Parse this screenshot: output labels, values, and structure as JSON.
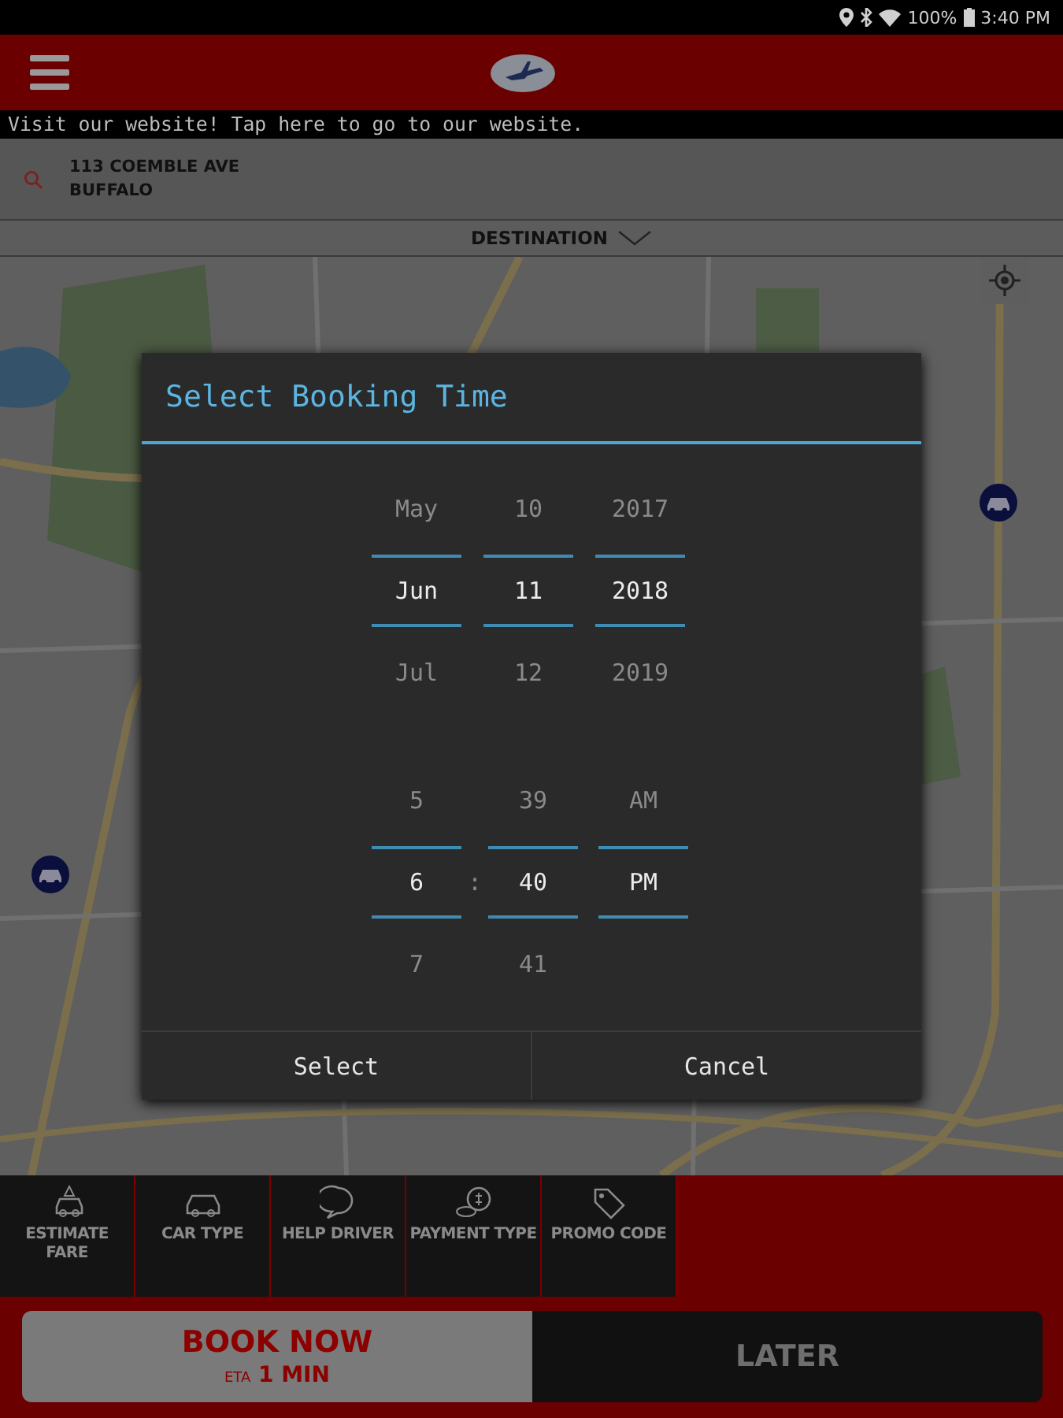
{
  "status_bar": {
    "battery": "100%",
    "time": "3:40 PM"
  },
  "banner": {
    "text": "Visit our website! Tap here to go to our website."
  },
  "pickup": {
    "lines": [
      "113 COEMBLE AVE",
      "BUFFALO"
    ]
  },
  "destination": {
    "label": "DESTINATION"
  },
  "dialog": {
    "title": "Select Booking Time",
    "date_columns": [
      {
        "items": [
          {
            "value": "May",
            "selected": false
          },
          {
            "value": "Jun",
            "selected": true
          },
          {
            "value": "Jul",
            "selected": false
          }
        ]
      },
      {
        "items": [
          {
            "value": "10",
            "selected": false
          },
          {
            "value": "11",
            "selected": true
          },
          {
            "value": "12",
            "selected": false
          }
        ]
      },
      {
        "items": [
          {
            "value": "2017",
            "selected": false
          },
          {
            "value": "2018",
            "selected": true
          },
          {
            "value": "2019",
            "selected": false
          }
        ]
      }
    ],
    "time_columns": [
      {
        "items": [
          {
            "value": "5",
            "selected": false
          },
          {
            "value": "6",
            "selected": true
          },
          {
            "value": "7",
            "selected": false
          }
        ]
      },
      {
        "items": [
          {
            "value": "39",
            "selected": false
          },
          {
            "value": "40",
            "selected": true
          },
          {
            "value": "41",
            "selected": false
          }
        ]
      },
      {
        "items": [
          {
            "value": "AM",
            "selected": false
          },
          {
            "value": "PM",
            "selected": true
          }
        ]
      }
    ],
    "time_separator": ":",
    "buttons": [
      "Select",
      "Cancel"
    ]
  },
  "toolbar": [
    {
      "kind": "estimate",
      "label": "ESTIMATE FARE"
    },
    {
      "kind": "car",
      "label": "CAR TYPE"
    },
    {
      "kind": "chat",
      "label": "HELP DRIVER"
    },
    {
      "kind": "payment",
      "label": "PAYMENT TYPE"
    },
    {
      "kind": "tag",
      "label": "PROMO CODE"
    }
  ],
  "booking": [
    {
      "kind": "now",
      "label": "BOOK NOW",
      "eta_label": "ETA",
      "eta": "1 MIN",
      "selected": true
    },
    {
      "kind": "later",
      "label": "LATER",
      "selected": false
    }
  ]
}
